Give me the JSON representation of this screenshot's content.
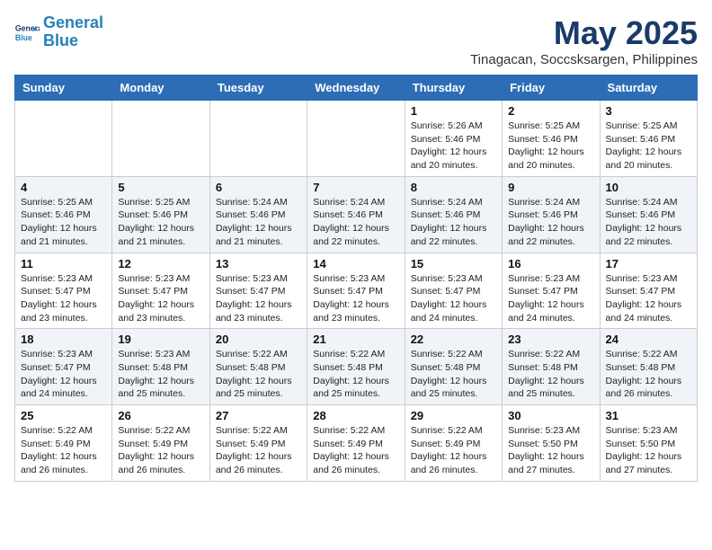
{
  "header": {
    "logo_line1": "General",
    "logo_line2": "Blue",
    "month": "May 2025",
    "location": "Tinagacan, Soccsksargen, Philippines"
  },
  "weekdays": [
    "Sunday",
    "Monday",
    "Tuesday",
    "Wednesday",
    "Thursday",
    "Friday",
    "Saturday"
  ],
  "weeks": [
    [
      {
        "day": "",
        "detail": ""
      },
      {
        "day": "",
        "detail": ""
      },
      {
        "day": "",
        "detail": ""
      },
      {
        "day": "",
        "detail": ""
      },
      {
        "day": "1",
        "detail": "Sunrise: 5:26 AM\nSunset: 5:46 PM\nDaylight: 12 hours\nand 20 minutes."
      },
      {
        "day": "2",
        "detail": "Sunrise: 5:25 AM\nSunset: 5:46 PM\nDaylight: 12 hours\nand 20 minutes."
      },
      {
        "day": "3",
        "detail": "Sunrise: 5:25 AM\nSunset: 5:46 PM\nDaylight: 12 hours\nand 20 minutes."
      }
    ],
    [
      {
        "day": "4",
        "detail": "Sunrise: 5:25 AM\nSunset: 5:46 PM\nDaylight: 12 hours\nand 21 minutes."
      },
      {
        "day": "5",
        "detail": "Sunrise: 5:25 AM\nSunset: 5:46 PM\nDaylight: 12 hours\nand 21 minutes."
      },
      {
        "day": "6",
        "detail": "Sunrise: 5:24 AM\nSunset: 5:46 PM\nDaylight: 12 hours\nand 21 minutes."
      },
      {
        "day": "7",
        "detail": "Sunrise: 5:24 AM\nSunset: 5:46 PM\nDaylight: 12 hours\nand 22 minutes."
      },
      {
        "day": "8",
        "detail": "Sunrise: 5:24 AM\nSunset: 5:46 PM\nDaylight: 12 hours\nand 22 minutes."
      },
      {
        "day": "9",
        "detail": "Sunrise: 5:24 AM\nSunset: 5:46 PM\nDaylight: 12 hours\nand 22 minutes."
      },
      {
        "day": "10",
        "detail": "Sunrise: 5:24 AM\nSunset: 5:46 PM\nDaylight: 12 hours\nand 22 minutes."
      }
    ],
    [
      {
        "day": "11",
        "detail": "Sunrise: 5:23 AM\nSunset: 5:47 PM\nDaylight: 12 hours\nand 23 minutes."
      },
      {
        "day": "12",
        "detail": "Sunrise: 5:23 AM\nSunset: 5:47 PM\nDaylight: 12 hours\nand 23 minutes."
      },
      {
        "day": "13",
        "detail": "Sunrise: 5:23 AM\nSunset: 5:47 PM\nDaylight: 12 hours\nand 23 minutes."
      },
      {
        "day": "14",
        "detail": "Sunrise: 5:23 AM\nSunset: 5:47 PM\nDaylight: 12 hours\nand 23 minutes."
      },
      {
        "day": "15",
        "detail": "Sunrise: 5:23 AM\nSunset: 5:47 PM\nDaylight: 12 hours\nand 24 minutes."
      },
      {
        "day": "16",
        "detail": "Sunrise: 5:23 AM\nSunset: 5:47 PM\nDaylight: 12 hours\nand 24 minutes."
      },
      {
        "day": "17",
        "detail": "Sunrise: 5:23 AM\nSunset: 5:47 PM\nDaylight: 12 hours\nand 24 minutes."
      }
    ],
    [
      {
        "day": "18",
        "detail": "Sunrise: 5:23 AM\nSunset: 5:47 PM\nDaylight: 12 hours\nand 24 minutes."
      },
      {
        "day": "19",
        "detail": "Sunrise: 5:23 AM\nSunset: 5:48 PM\nDaylight: 12 hours\nand 25 minutes."
      },
      {
        "day": "20",
        "detail": "Sunrise: 5:22 AM\nSunset: 5:48 PM\nDaylight: 12 hours\nand 25 minutes."
      },
      {
        "day": "21",
        "detail": "Sunrise: 5:22 AM\nSunset: 5:48 PM\nDaylight: 12 hours\nand 25 minutes."
      },
      {
        "day": "22",
        "detail": "Sunrise: 5:22 AM\nSunset: 5:48 PM\nDaylight: 12 hours\nand 25 minutes."
      },
      {
        "day": "23",
        "detail": "Sunrise: 5:22 AM\nSunset: 5:48 PM\nDaylight: 12 hours\nand 25 minutes."
      },
      {
        "day": "24",
        "detail": "Sunrise: 5:22 AM\nSunset: 5:48 PM\nDaylight: 12 hours\nand 26 minutes."
      }
    ],
    [
      {
        "day": "25",
        "detail": "Sunrise: 5:22 AM\nSunset: 5:49 PM\nDaylight: 12 hours\nand 26 minutes."
      },
      {
        "day": "26",
        "detail": "Sunrise: 5:22 AM\nSunset: 5:49 PM\nDaylight: 12 hours\nand 26 minutes."
      },
      {
        "day": "27",
        "detail": "Sunrise: 5:22 AM\nSunset: 5:49 PM\nDaylight: 12 hours\nand 26 minutes."
      },
      {
        "day": "28",
        "detail": "Sunrise: 5:22 AM\nSunset: 5:49 PM\nDaylight: 12 hours\nand 26 minutes."
      },
      {
        "day": "29",
        "detail": "Sunrise: 5:22 AM\nSunset: 5:49 PM\nDaylight: 12 hours\nand 26 minutes."
      },
      {
        "day": "30",
        "detail": "Sunrise: 5:23 AM\nSunset: 5:50 PM\nDaylight: 12 hours\nand 27 minutes."
      },
      {
        "day": "31",
        "detail": "Sunrise: 5:23 AM\nSunset: 5:50 PM\nDaylight: 12 hours\nand 27 minutes."
      }
    ]
  ]
}
